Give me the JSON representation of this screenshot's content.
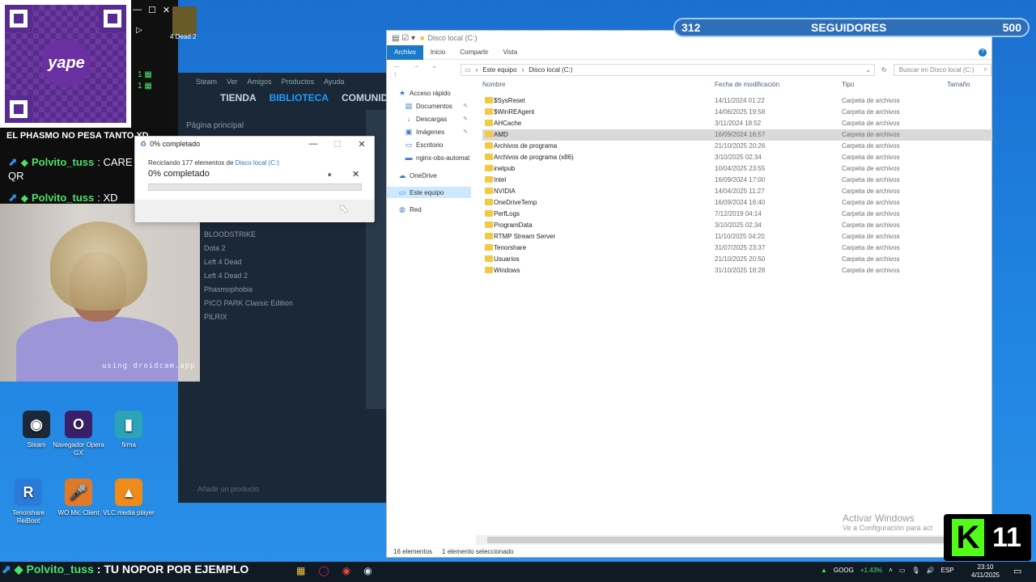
{
  "overlay": {
    "qr_logo": "yape",
    "chat_banner": "EL PHASMO NO PESA TANTO XD",
    "chat": [
      {
        "user": "Polvito_tuss",
        "message": ": CARE"
      },
      {
        "user": "",
        "message": "QR"
      },
      {
        "user": "Polvito_tuss",
        "message": ": XD"
      }
    ],
    "webcam_watermark": "using droidcam.app",
    "followers": {
      "current": "312",
      "label": "SEGUIDORES",
      "goal": "500"
    },
    "kick_count": "11",
    "bottom_chat": {
      "user": "Polvito_tuss",
      "message": ": TU NOPOR POR EJEMPLO"
    },
    "top_game_label": "4 Dead 2"
  },
  "steam": {
    "menu": [
      "Steam",
      "Ver",
      "Amigos",
      "Productos",
      "Ayuda"
    ],
    "nav": [
      "TIENDA",
      "BIBLIOTECA",
      "COMUNIDAD"
    ],
    "home": "Página principal",
    "library": [
      "BLOODSTRIKE",
      "Dota 2",
      "Left 4 Dead",
      "Left 4 Dead 2",
      "Phasmophobia",
      "PICO PARK Classic Edition",
      "PILRIX"
    ],
    "add_product": "Añadir un producto"
  },
  "dialog": {
    "title": "0% completado",
    "line_prefix": "Reciclando 177 elementos de",
    "line_link": "Disco local (C:)",
    "percent_text": "0% completado",
    "pause": "⏸",
    "close": "✕",
    "progress": 0
  },
  "desktop_icons": [
    {
      "label": "Steam",
      "glyph": "◉",
      "color": "#1b2838"
    },
    {
      "label": "Navegador Opera GX",
      "glyph": "O",
      "color": "#3a1f6a"
    },
    {
      "label": "firma",
      "glyph": "▮",
      "color": "#2ba3b8"
    },
    {
      "label": "Tenorshare ReiBoot",
      "glyph": "R",
      "color": "#2a7ad8"
    },
    {
      "label": "WO Mic Client",
      "glyph": "🎤",
      "color": "#e07a2a"
    },
    {
      "label": "VLC media player",
      "glyph": "▲",
      "color": "#f08a1a"
    }
  ],
  "explorer": {
    "title": "Disco local (C:)",
    "ribbon": [
      "Archivo",
      "Inicio",
      "Compartir",
      "Vista"
    ],
    "path": [
      "Este equipo",
      "Disco local (C:)"
    ],
    "search_placeholder": "Buscar en Disco local (C:)",
    "nav": [
      {
        "label": "Acceso rápido",
        "icon": "★",
        "pin": false
      },
      {
        "label": "Documentos",
        "icon": "▤",
        "pin": true
      },
      {
        "label": "Descargas",
        "icon": "↓",
        "pin": true
      },
      {
        "label": "Imágenes",
        "icon": "▣",
        "pin": true
      },
      {
        "label": "Escritorio",
        "icon": "▭",
        "pin": false
      },
      {
        "label": "nginx-obs-automat",
        "icon": "▬",
        "pin": false
      },
      {
        "label": "OneDrive",
        "icon": "☁",
        "pin": false
      },
      {
        "label": "Este equipo",
        "icon": "▭",
        "pin": false
      },
      {
        "label": "Red",
        "icon": "◍",
        "pin": false
      }
    ],
    "columns": [
      "Nombre",
      "Fecha de modificación",
      "Tipo",
      "Tamaño"
    ],
    "rows": [
      {
        "name": "$SysReset",
        "date": "14/11/2024 01:22",
        "type": "Carpeta de archivos"
      },
      {
        "name": "$WinREAgent",
        "date": "14/06/2025 19:58",
        "type": "Carpeta de archivos"
      },
      {
        "name": "AHCache",
        "date": "3/11/2024 18:52",
        "type": "Carpeta de archivos"
      },
      {
        "name": "AMD",
        "date": "16/09/2024 16:57",
        "type": "Carpeta de archivos"
      },
      {
        "name": "Archivos de programa",
        "date": "21/10/2025 20:26",
        "type": "Carpeta de archivos"
      },
      {
        "name": "Archivos de programa (x86)",
        "date": "3/10/2025 02:34",
        "type": "Carpeta de archivos"
      },
      {
        "name": "inetpub",
        "date": "10/04/2025 23:55",
        "type": "Carpeta de archivos"
      },
      {
        "name": "Intel",
        "date": "16/09/2024 17:00",
        "type": "Carpeta de archivos"
      },
      {
        "name": "NVIDIA",
        "date": "14/04/2025 11:27",
        "type": "Carpeta de archivos"
      },
      {
        "name": "OneDriveTemp",
        "date": "16/09/2024 16:40",
        "type": "Carpeta de archivos"
      },
      {
        "name": "PerfLogs",
        "date": "7/12/2019 04:14",
        "type": "Carpeta de archivos"
      },
      {
        "name": "ProgramData",
        "date": "3/10/2025 02:34",
        "type": "Carpeta de archivos"
      },
      {
        "name": "RTMP Stream Server",
        "date": "11/10/2025 04:20",
        "type": "Carpeta de archivos"
      },
      {
        "name": "Tenorshare",
        "date": "31/07/2025 23:37",
        "type": "Carpeta de archivos"
      },
      {
        "name": "Usuarios",
        "date": "21/10/2025 20:50",
        "type": "Carpeta de archivos"
      },
      {
        "name": "Windows",
        "date": "31/10/2025 18:28",
        "type": "Carpeta de archivos"
      }
    ],
    "status_count": "16 elementos",
    "status_selected": "1 elemento seleccionado",
    "selected_row": 3
  },
  "watermark": {
    "title": "Activar Windows",
    "subtitle": "Ve a Configuración para act"
  },
  "taskbar": {
    "stock_symbol": "GOOG",
    "stock_change": "+1.43%",
    "language": "ESP",
    "time": "23:10",
    "date": "4/11/2025"
  }
}
